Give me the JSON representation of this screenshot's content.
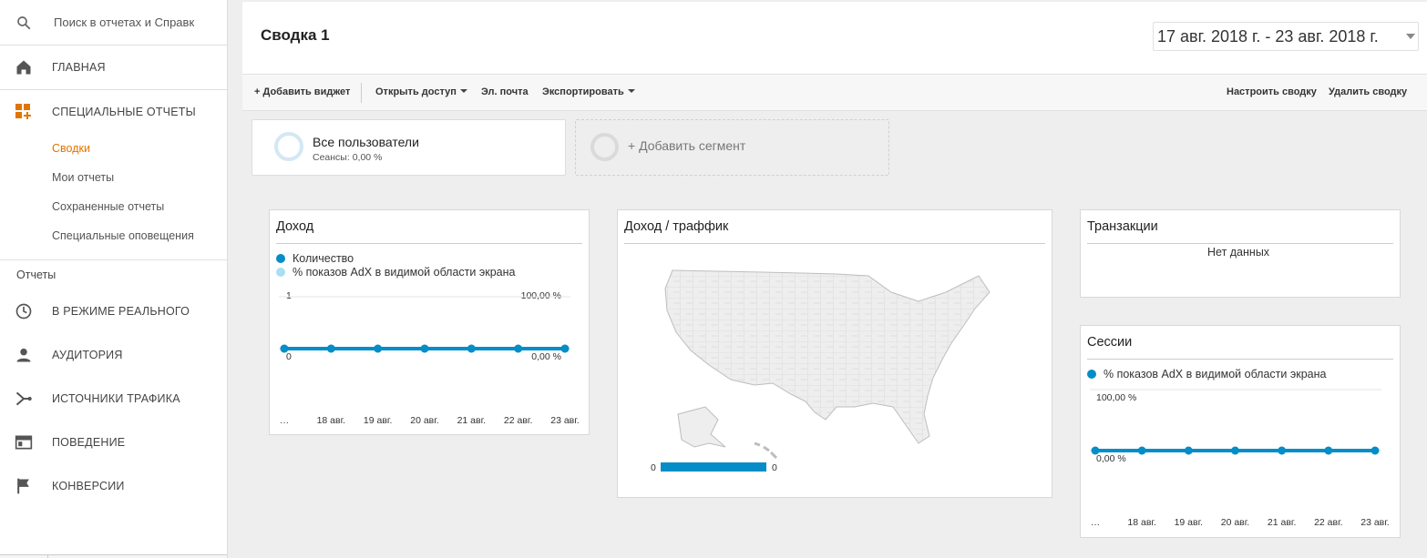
{
  "sidebar": {
    "search_placeholder": "Поиск в отчетах и Справк",
    "home": "ГЛАВНАЯ",
    "custom_reports": "СПЕЦИАЛЬНЫЕ ОТЧЕТЫ",
    "sub_items": [
      "Сводки",
      "Мои отчеты",
      "Сохраненные отчеты",
      "Специальные оповещения"
    ],
    "reports_header": "Отчеты",
    "reports": [
      {
        "label": "В РЕЖИМЕ РЕАЛЬНОГО",
        "icon": "clock-icon"
      },
      {
        "label": "АУДИТОРИЯ",
        "icon": "person-icon"
      },
      {
        "label": "ИСТОЧНИКИ ТРАФИКА",
        "icon": "acquisition-icon"
      },
      {
        "label": "ПОВЕДЕНИЕ",
        "icon": "behavior-icon"
      },
      {
        "label": "КОНВЕРСИИ",
        "icon": "flag-icon"
      }
    ]
  },
  "header": {
    "title": "Сводка 1",
    "date_range": "17 авг. 2018 г. - 23 авг. 2018 г."
  },
  "toolbar": {
    "add_widget": "+ Добавить виджет",
    "share": "Открыть доступ",
    "email": "Эл. почта",
    "export": "Экспортировать",
    "customize": "Настроить сводку",
    "delete": "Удалить сводку"
  },
  "segments": {
    "all_users": "Все пользователи",
    "all_users_sub": "Сеансы: 0,00 %",
    "add_segment": "+ Добавить сегмент"
  },
  "widgets": {
    "revenue": {
      "title": "Доход",
      "legend": [
        "Количество",
        "% показов AdX в видимой области экрана"
      ],
      "y_left_top": "1",
      "y_left_bottom": "0",
      "y_right_top": "100,00 %",
      "y_right_bottom": "0,00 %"
    },
    "revenue_traffic": {
      "title": "Доход / траффик",
      "scale_min": "0",
      "scale_max": "0"
    },
    "transactions": {
      "title": "Транзакции",
      "no_data": "Нет данных"
    },
    "sessions": {
      "title": "Сессии",
      "legend": [
        "% показов AdX в видимой области экрана"
      ],
      "y_top": "100,00 %",
      "y_bottom": "0,00 %"
    }
  },
  "chart_data": [
    {
      "type": "line",
      "title": "Доход",
      "categories": [
        "…",
        "18 авг.",
        "19 авг.",
        "20 авг.",
        "21 авг.",
        "22 авг.",
        "23 авг."
      ],
      "series": [
        {
          "name": "Количество",
          "values": [
            0,
            0,
            0,
            0,
            0,
            0,
            0
          ],
          "color": "#058dc7"
        },
        {
          "name": "% показов AdX в видимой области экрана",
          "values": [
            0,
            0,
            0,
            0,
            0,
            0,
            0
          ],
          "color": "#aadff3"
        }
      ],
      "ylim": [
        0,
        1
      ]
    },
    {
      "type": "line",
      "title": "Сессии",
      "categories": [
        "…",
        "18 авг.",
        "19 авг.",
        "20 авг.",
        "21 авг.",
        "22 авг.",
        "23 авг."
      ],
      "series": [
        {
          "name": "% показов AdX в видимой области экрана",
          "values": [
            0,
            0,
            0,
            0,
            0,
            0,
            0
          ],
          "color": "#058dc7"
        }
      ],
      "ylim": [
        0,
        100
      ]
    }
  ],
  "colors": {
    "accent": "#e37400",
    "series_dark": "#058dc7",
    "series_light": "#aadff3"
  }
}
